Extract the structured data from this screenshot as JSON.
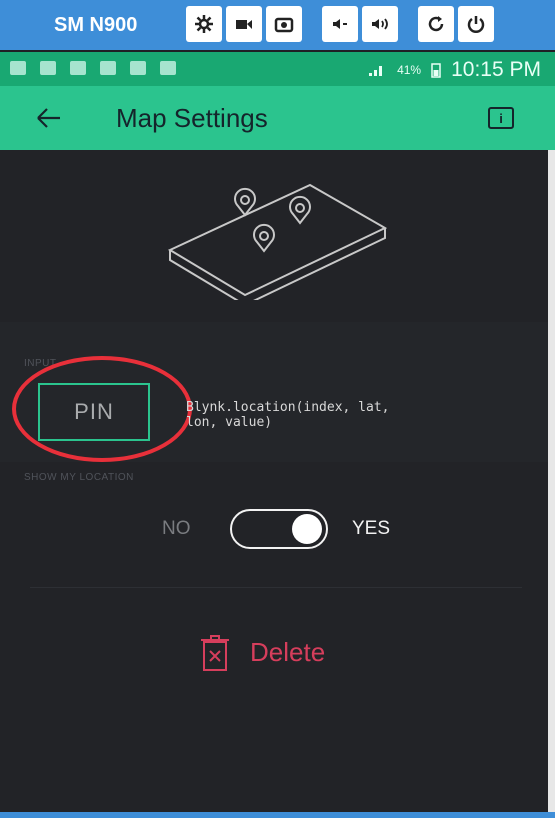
{
  "emulator": {
    "device_title": "SM N900",
    "controls": [
      "gear-icon",
      "video-icon",
      "camera-icon",
      "volume-down-icon",
      "volume-up-icon",
      "rotate-icon",
      "power-icon"
    ]
  },
  "status_bar": {
    "battery_percent": "41%",
    "time": "10:15 PM"
  },
  "header": {
    "title": "Map Settings",
    "info_label": "i"
  },
  "pin_section": {
    "label": "INPUT",
    "pin_label": "PIN",
    "code_hint": "Blynk.location(index, lat,\nlon, value)"
  },
  "location_section": {
    "label": "SHOW MY LOCATION",
    "off_label": "NO",
    "on_label": "YES",
    "enabled": true
  },
  "actions": {
    "delete_label": "Delete"
  },
  "colors": {
    "header": "#2bc48e",
    "status_bar": "#19a872",
    "emulator_bar": "#3e8ed8",
    "delete": "#d63e5c",
    "highlight": "#e8303a"
  }
}
